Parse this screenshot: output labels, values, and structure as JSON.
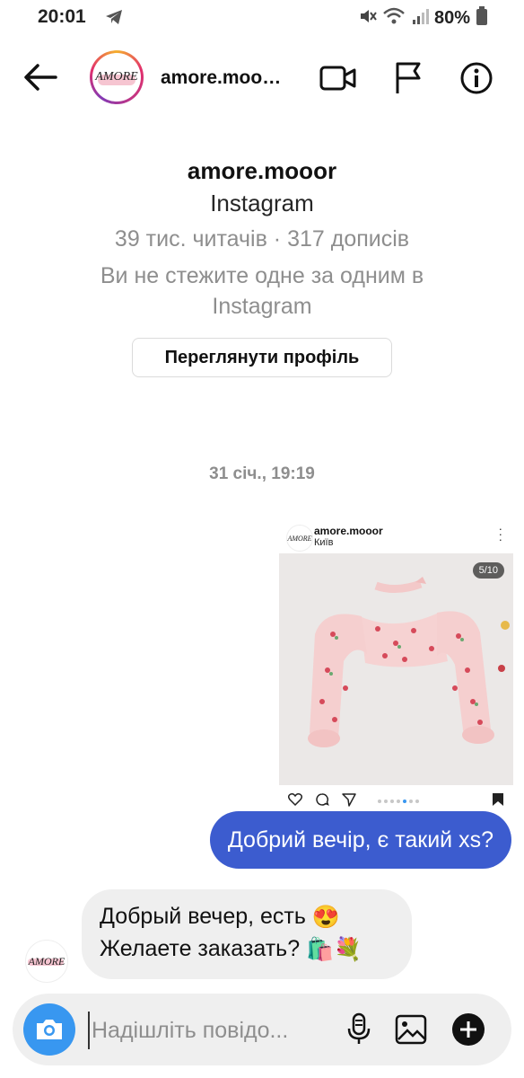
{
  "status_bar": {
    "time": "20:01",
    "battery": "80%"
  },
  "header": {
    "logo_text": "AMORE",
    "username": "amore.moo…"
  },
  "profile": {
    "name": "amore.mooor",
    "platform": "Instagram",
    "stats": "39 тис. читачів · 317 дописів",
    "follow_status": "Ви не стежите одне за одним в Instagram",
    "view_profile_label": "Переглянути профіль"
  },
  "conversation": {
    "date": "31 січ., 19:19",
    "shared_post": {
      "username": "amore.mooor",
      "location": "Київ",
      "page_counter": "5/10"
    },
    "outgoing_message": "Добрий вечір, є такий xs?",
    "incoming_message": {
      "line1": "Добрый вечер, есть",
      "line2": "Желаете заказать?",
      "emoji1": "😍",
      "emoji2": "🛍️💐"
    }
  },
  "composer": {
    "placeholder": "Надішліть повідо..."
  },
  "colors": {
    "outgoing_bubble": "#3c5ccf",
    "camera_button": "#3897f0",
    "incoming_bubble": "#efefef"
  }
}
